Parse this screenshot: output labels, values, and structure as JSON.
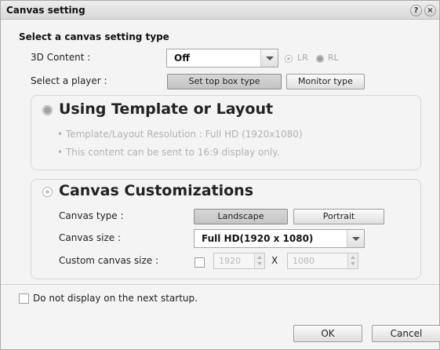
{
  "window": {
    "title": "Canvas setting",
    "help_glyph": "?",
    "close_glyph": "×"
  },
  "heading": "Select a canvas setting type",
  "content3d": {
    "label": "3D Content :",
    "selected": "Off",
    "options": {
      "lr": "LR",
      "rl": "RL"
    }
  },
  "player": {
    "label": "Select a player :",
    "buttons": {
      "set_top_box": "Set top box type",
      "monitor": "Monitor type"
    },
    "selected": "Set top box type"
  },
  "template_group": {
    "title": "Using Template or Layout",
    "selected": true,
    "lines": [
      "• Template/Layout Resolution : Full HD (1920x1080)",
      "• This content can be sent to 16:9 display only."
    ]
  },
  "custom_group": {
    "title": "Canvas Customizations",
    "selected": false,
    "canvas_type": {
      "label": "Canvas type :",
      "landscape": "Landscape",
      "portrait": "Portrait",
      "selected": "Landscape"
    },
    "canvas_size": {
      "label": "Canvas size :",
      "selected": "Full HD(1920 x 1080)"
    },
    "custom_size": {
      "label": "Custom canvas size :",
      "checked": false,
      "width": "1920",
      "separator": "X",
      "height": "1080"
    }
  },
  "footer": {
    "dont_show_label": "Do not display on the next startup.",
    "dont_show_checked": false,
    "ok": "OK",
    "cancel": "Cancel"
  },
  "icons": [
    "help-icon",
    "close-icon",
    "chevron-down-icon",
    "spin-up-icon",
    "spin-down-icon"
  ],
  "colors": {
    "window_bg": "#f4f4f4",
    "title_bar": "#e0e0e0",
    "disabled_text": "#b2b2b2",
    "group_border": "#d6d6d6"
  }
}
